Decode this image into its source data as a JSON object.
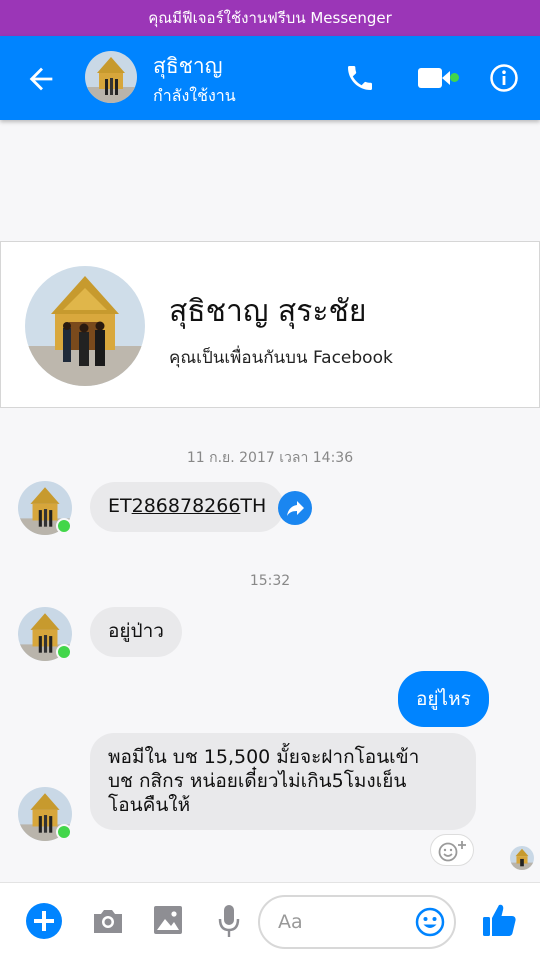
{
  "banner": {
    "text": "คุณมีฟีเจอร์ใช้งานฟรีบน Messenger"
  },
  "header": {
    "contact_name": "สุธิชาญ",
    "status": "กำลังใช้งาน"
  },
  "profile": {
    "full_name": "สุธิชาญ สุระชัย",
    "subtitle": "คุณเป็นเพื่อนกันบน Facebook"
  },
  "messages": {
    "date_1": "11 ก.ย. 2017 เวลา 14:36",
    "msg_1_prefix": "ET",
    "msg_1_link": "286878266",
    "msg_1_suffix": "TH",
    "time_2": "15:32",
    "msg_2": "อยู่ป่าว",
    "msg_3": "อยู่ไหร",
    "msg_4_line1": "พอมีใน บช 15,500 มั้ยจะฝากโอนเข้า",
    "msg_4_line2": "บช กสิกร หน่อยเดี๋ยวไม่เกิน5โมงเย็น",
    "msg_4_line3": "โอนคืนให้"
  },
  "composer": {
    "placeholder": "Aa"
  },
  "colors": {
    "brand": "#0084ff",
    "banner": "#9b36b7",
    "online": "#42d64a"
  },
  "icons": [
    "back-arrow-icon",
    "phone-icon",
    "video-camera-icon",
    "info-icon",
    "share-icon",
    "add-reaction-icon",
    "plus-icon",
    "camera-icon",
    "image-icon",
    "microphone-icon",
    "emoji-icon",
    "thumbs-up-icon"
  ]
}
